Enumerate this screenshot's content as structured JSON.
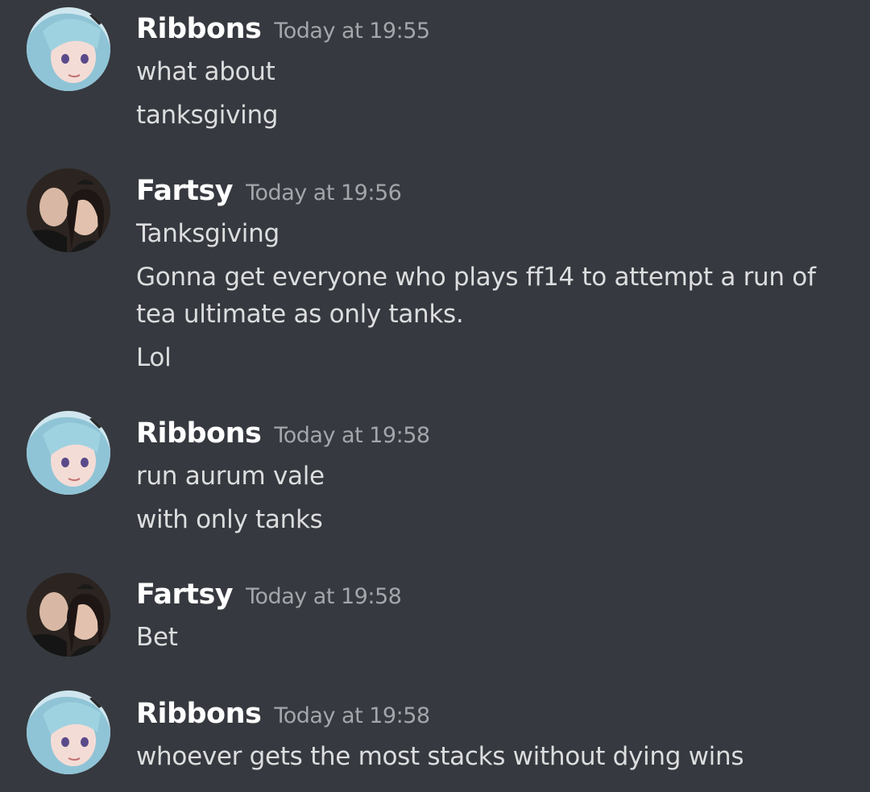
{
  "messages": [
    {
      "author": "Ribbons",
      "timestamp": "Today at 19:55",
      "avatar_icon": "anime-girl-avatar",
      "lines": [
        "what about",
        "tanksgiving"
      ]
    },
    {
      "author": "Fartsy",
      "timestamp": "Today at 19:56",
      "avatar_icon": "couple-photo-avatar",
      "lines": [
        "Tanksgiving",
        "Gonna get everyone who plays ff14 to attempt a run of tea ultimate as only tanks.",
        "Lol"
      ]
    },
    {
      "author": "Ribbons",
      "timestamp": "Today at 19:58",
      "avatar_icon": "anime-girl-avatar",
      "lines": [
        "run aurum vale",
        "with only tanks"
      ]
    },
    {
      "author": "Fartsy",
      "timestamp": "Today at 19:58",
      "avatar_icon": "couple-photo-avatar",
      "lines": [
        "Bet"
      ]
    },
    {
      "author": "Ribbons",
      "timestamp": "Today at 19:58",
      "avatar_icon": "anime-girl-avatar",
      "lines": [
        "whoever gets the most stacks without dying wins"
      ]
    }
  ],
  "colors": {
    "background": "#36393f",
    "username": "#ffffff",
    "timestamp": "#a3a6aa",
    "message_text": "#dcddde"
  }
}
